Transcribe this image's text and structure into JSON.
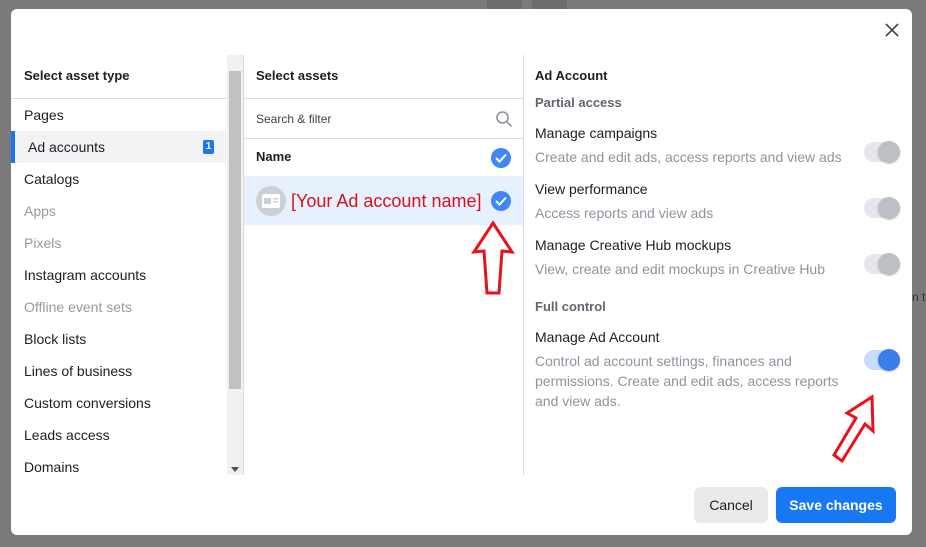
{
  "background": {
    "peek_text": "n t"
  },
  "dialog": {
    "close_icon": "close-icon",
    "left": {
      "title": "Select asset type",
      "items": [
        {
          "label": "Pages",
          "state": "normal"
        },
        {
          "label": "Ad accounts",
          "state": "selected",
          "badge": "1"
        },
        {
          "label": "Catalogs",
          "state": "normal"
        },
        {
          "label": "Apps",
          "state": "disabled"
        },
        {
          "label": "Pixels",
          "state": "disabled"
        },
        {
          "label": "Instagram accounts",
          "state": "normal"
        },
        {
          "label": "Offline event sets",
          "state": "disabled"
        },
        {
          "label": "Block lists",
          "state": "normal"
        },
        {
          "label": "Lines of business",
          "state": "normal"
        },
        {
          "label": "Custom conversions",
          "state": "normal"
        },
        {
          "label": "Leads access",
          "state": "normal"
        },
        {
          "label": "Domains",
          "state": "normal"
        }
      ]
    },
    "middle": {
      "title": "Select assets",
      "search_placeholder": "Search & filter",
      "name_header": "Name",
      "asset_name": "[Your Ad account name]"
    },
    "right": {
      "title": "Ad Account",
      "partial_title": "Partial access",
      "full_title": "Full control",
      "permissions": [
        {
          "title": "Manage campaigns",
          "desc": "Create and edit ads, access reports and view ads",
          "enabled": false
        },
        {
          "title": "View performance",
          "desc": "Access reports and view ads",
          "enabled": false
        },
        {
          "title": "Manage Creative Hub mockups",
          "desc": "View, create and edit mockups in Creative Hub",
          "enabled": false
        }
      ],
      "full_permission": {
        "title": "Manage Ad Account",
        "desc": "Control ad account settings, finances and permissions. Create and edit ads, access reports and view ads.",
        "enabled": true
      }
    },
    "footer": {
      "cancel_label": "Cancel",
      "save_label": "Save changes"
    }
  },
  "colors": {
    "accent": "#1877f2",
    "annotation": "#e8111c",
    "toggle_on": "#3b7de9"
  }
}
